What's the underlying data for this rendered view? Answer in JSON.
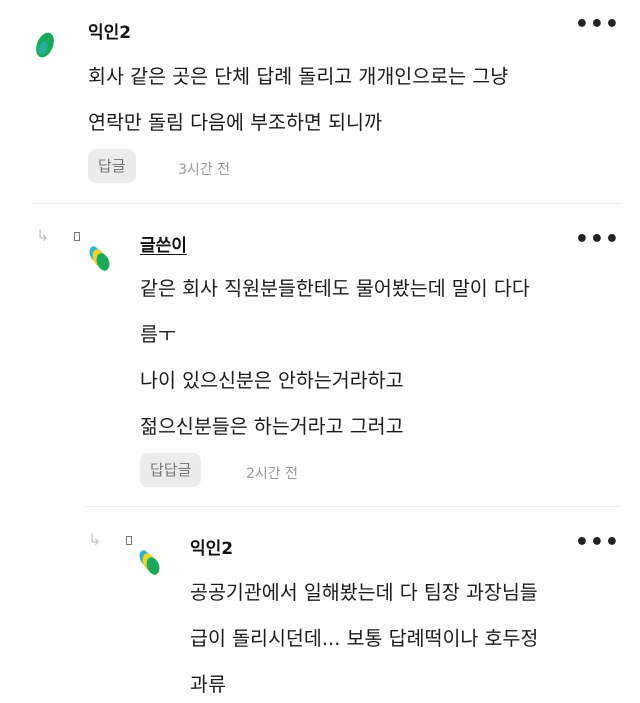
{
  "more_glyph": "•••",
  "reply_arrow": "↳",
  "comments": [
    {
      "name": "익인2",
      "lines": [
        "회사 같은 곳은 단체 답례 돌리고 개개인으로는 그냥",
        "연락만 돌림 다음에 부조하면 되니까"
      ],
      "reply_label": "답글",
      "time": "3시간 전"
    },
    {
      "name": "글쓴이",
      "lines": [
        "같은 회사 직원분들한테도 물어봤는데 말이 다다",
        "름ㅜ",
        "나이 있으신분은 안하는거라하고",
        "젊으신분들은 하는거라고 그러고"
      ],
      "reply_label": "답답글",
      "time": "2시간 전"
    },
    {
      "name": "익인2",
      "lines": [
        "공공기관에서 일해봤는데 다 팀장 과장님들",
        "급이 돌리시던데... 보통 답례떡이나 호두정",
        "과류"
      ]
    }
  ],
  "colors": {
    "avatar_green": "#1aa85a",
    "avatar_yellow": "#f2d22e",
    "avatar_teal": "#2bb6c9"
  }
}
